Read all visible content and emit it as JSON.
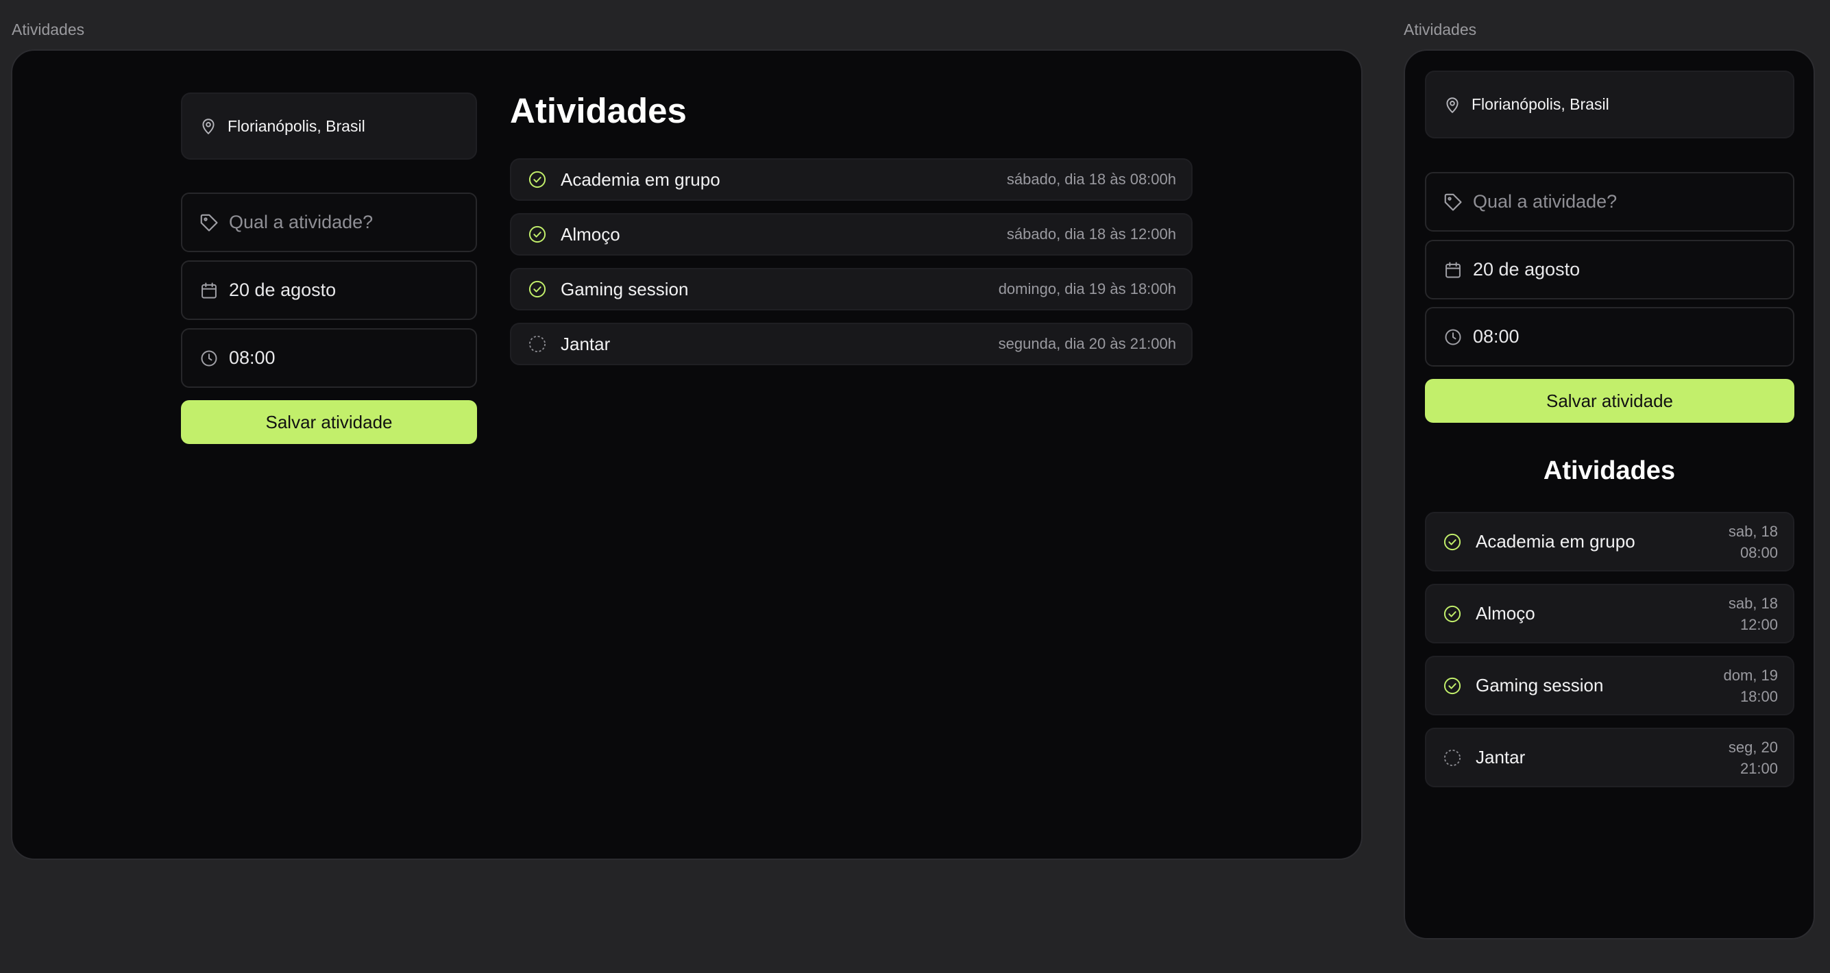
{
  "frames": {
    "desktop_label": "Atividades",
    "mobile_label": "Atividades"
  },
  "location": {
    "icon": "map-pin-icon",
    "text": "Florianópolis, Brasil"
  },
  "form": {
    "activity_placeholder": "Qual a atividade?",
    "activity_icon": "tag-icon",
    "date_value": "20 de agosto",
    "date_icon": "calendar-icon",
    "time_value": "08:00",
    "time_icon": "clock-icon",
    "save_label": "Salvar atividade"
  },
  "activities_title": "Atividades",
  "activities": [
    {
      "name": "Academia em grupo",
      "when": "sábado, dia 18 às 08:00h",
      "when_short_day": "sab, 18",
      "when_short_time": "08:00",
      "done": true
    },
    {
      "name": "Almoço",
      "when": "sábado, dia 18 às 12:00h",
      "when_short_day": "sab, 18",
      "when_short_time": "12:00",
      "done": true
    },
    {
      "name": "Gaming session",
      "when": "domingo, dia 19 às 18:00h",
      "when_short_day": "dom, 19",
      "when_short_time": "18:00",
      "done": true
    },
    {
      "name": "Jantar",
      "when": "segunda, dia 20 às 21:00h",
      "when_short_day": "seg, 20",
      "when_short_time": "21:00",
      "done": false
    }
  ],
  "colors": {
    "accent": "#c2ef6b",
    "background": "#242426",
    "frame": "#09090b",
    "card": "#18181b",
    "muted_text": "#9a9aa0"
  }
}
